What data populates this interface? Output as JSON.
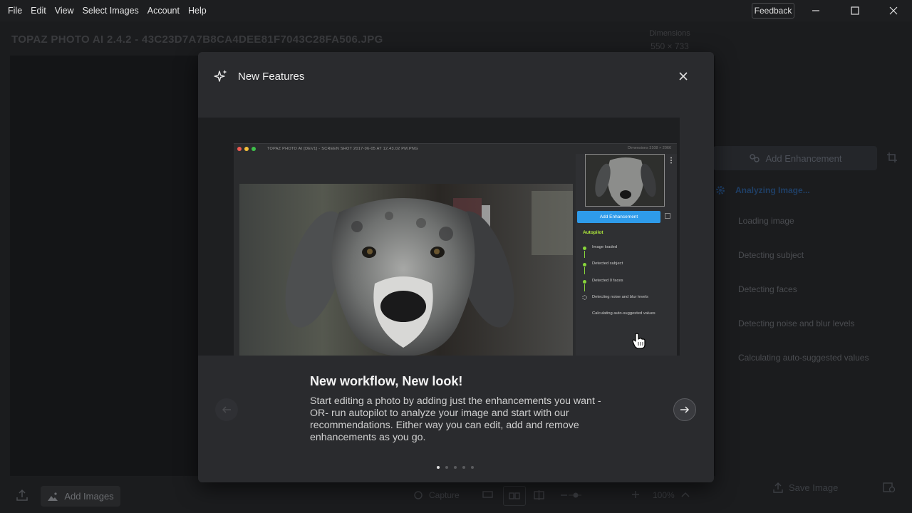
{
  "menu": {
    "items": [
      "File",
      "Edit",
      "View",
      "Select Images",
      "Account",
      "Help"
    ],
    "feedback_label": "Feedback"
  },
  "background": {
    "title": "TOPAZ PHOTO AI 2.4.2 - 43C23D7A7B8CA4DEE81F7043C28FA506.JPG",
    "dims_label": "Dimensions",
    "dims_value": "550 × 733",
    "add_enhancement_label": "Add Enhancement",
    "analyzing_label": "Analyzing Image...",
    "steps": [
      "Loading image",
      "Detecting subject",
      "Detecting faces",
      "Detecting noise and blur levels",
      "Calculating auto-suggested values"
    ],
    "add_images_label": "Add Images",
    "capture_label": "Capture",
    "zoom_label": "100%",
    "save_label": "Save Image"
  },
  "modal": {
    "title": "New Features",
    "slide_title": "New workflow, New look!",
    "slide_text": "Start editing a photo by adding just the enhancements you want -OR- run autopilot to analyze your image and start with our recommendations. Either way you can edit, add and remove enhancements as you go.",
    "pager": {
      "count": 5,
      "active_index": 0
    },
    "preview": {
      "title": "TOPAZ PHOTO AI [DEV1] - SCREEN SHOT 2017-06-05 AT 12.43.02 PM.PNG",
      "dims": "Dimensions  3108 × 2066",
      "add_enhancement_label": "Add Enhancement",
      "autopilot_label": "Autopilot",
      "steps": [
        "Image loaded",
        "Detected subject",
        "Detected 0 faces",
        "Detecting noise and blur levels",
        "Calculating auto-suggested values"
      ]
    }
  },
  "colors": {
    "accent": "#2e9bea",
    "autopilot_green": "#b4f03c",
    "modal_bg": "#2a2b2e"
  }
}
